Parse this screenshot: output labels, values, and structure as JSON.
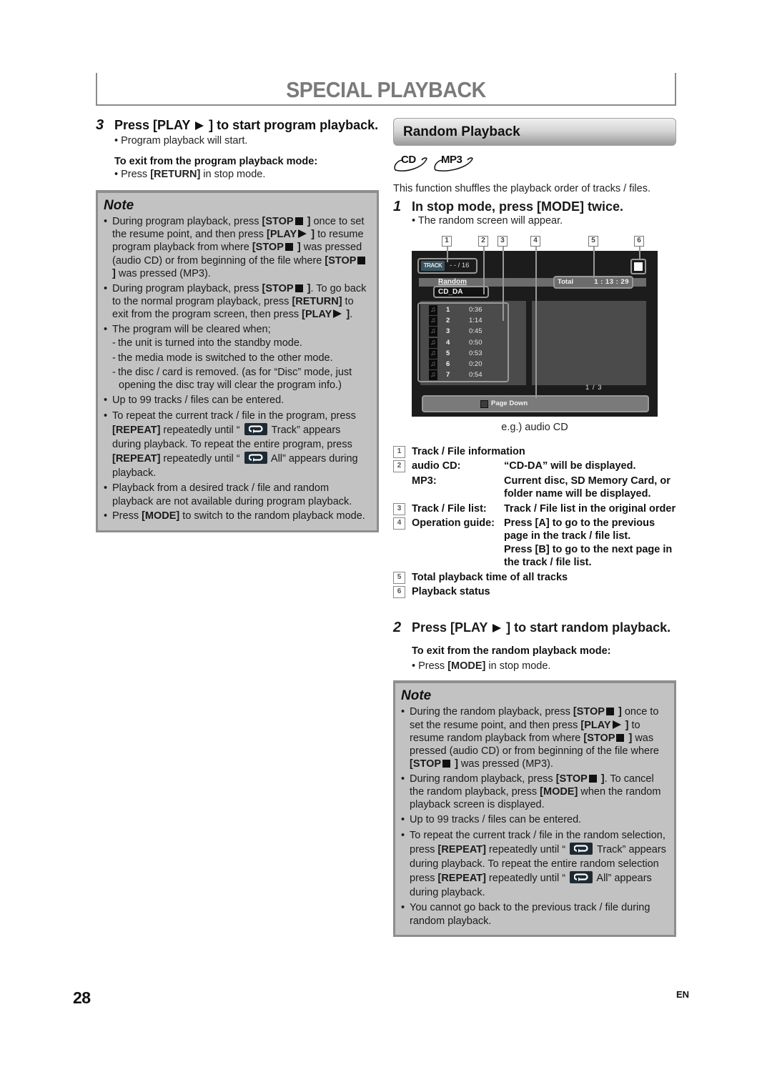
{
  "header": {
    "title": "SPECIAL PLAYBACK"
  },
  "left": {
    "step3": {
      "number": "3",
      "heading": "Press [PLAY ► ] to start program playback.",
      "heading_pre": "Press [PLAY",
      "heading_post": "] to start program playback.",
      "bullet": "• Program playback will start.",
      "exit_label": "To exit from the program playback mode:",
      "exit_bullet_pre": "• Press ",
      "exit_bullet_key": "[RETURN]",
      "exit_bullet_post": " in stop mode."
    },
    "note": {
      "title": "Note",
      "items": [
        "During program playback, press [STOP ■ ] once to set the resume point, and then press [PLAY ► ] to resume program playback from where [STOP ■ ] was pressed (audio CD) or from beginning of the file where [STOP ■ ] was pressed (MP3).",
        "During program playback, press [STOP ■ ]. To go back to the normal program playback, press [RETURN] to exit from the program screen, then press [PLAY ► ].",
        "The program will be cleared when;",
        "Up to 99 tracks / files can be entered.",
        "To repeat the current track / file in the program, press [REPEAT] repeatedly until “ [repeat] Track” appears during playback. To repeat the entire program, press [REPEAT] repeatedly until “ [repeat] All” appears during playback.",
        "Playback from a desired track / file and random playback are not available during program playback.",
        "Press [MODE] to switch to the random playback mode."
      ],
      "sub_items": [
        "- the unit is turned into the standby mode.",
        "- the media mode is switched to the other mode.",
        "- the disc / card is removed. (as for “Disc” mode, just opening the disc tray will clear the program info.)"
      ],
      "frag": {
        "i1a": "During program playback, press ",
        "stop": "[STOP",
        "close": " ]",
        "i1b": " once to set the resume point, and then press ",
        "play": "[PLAY",
        "i1c": " to resume program playback from where ",
        "i1d": " was pressed (audio CD) or from beginning of the file where ",
        "i1e": " was pressed (MP3).",
        "i2a": "During program playback, press ",
        "i2b": ". To go back to the normal program playback, press ",
        "return": "[RETURN]",
        "i2c": " to exit from the program screen, then press ",
        "i2d": ".",
        "i3": "The program will be cleared when;",
        "s1": "the unit is turned into the standby mode.",
        "s2": "the media mode is switched to the other mode.",
        "s3a": "the disc / card is removed. (as for “Disc” mode, just",
        "s3b": "opening the disc tray will clear the program info.)",
        "i4": "Up to 99 tracks / files can be entered.",
        "i5a": "To repeat the current track / file in the program, press ",
        "repeat": "[REPEAT]",
        "i5b": " repeatedly until “ ",
        "i5c": " Track” appears during playback. To repeat the entire program, press ",
        "i5d": " repeatedly until “ ",
        "i5e": " All” appears during playback.",
        "i6": "Playback from a desired track / file and random playback are not available during program playback.",
        "i7a": "Press ",
        "mode": "[MODE]",
        "i7b": " to switch to the random playback mode."
      }
    }
  },
  "right": {
    "section_title": "Random Playback",
    "media": [
      "CD",
      "MP3"
    ],
    "intro": "This function shuffles the playback order of tracks / files.",
    "step1": {
      "number": "1",
      "heading": "In stop mode, press [MODE] twice.",
      "bullet": "• The random screen will appear."
    },
    "screen": {
      "callouts": [
        "1",
        "2",
        "3",
        "4",
        "5",
        "6"
      ],
      "track_label": "TRACK",
      "track_count": "- - / 16",
      "mode_label": "Random",
      "media_name": "CD_DA",
      "total_label": "Total",
      "total_time": "1 : 13 : 29",
      "tracks": [
        {
          "num": "1",
          "time": "0:36"
        },
        {
          "num": "2",
          "time": "1:14"
        },
        {
          "num": "3",
          "time": "0:45"
        },
        {
          "num": "4",
          "time": "0:50"
        },
        {
          "num": "5",
          "time": "0:53"
        },
        {
          "num": "6",
          "time": "0:20"
        },
        {
          "num": "7",
          "time": "0:54"
        }
      ],
      "page_indicator": "1  /  3",
      "page_down_label": "Page Down",
      "caption": "e.g.) audio CD"
    },
    "legend": [
      {
        "num": "1",
        "key": "Track / File information",
        "value": ""
      },
      {
        "num": "2",
        "key": "audio CD:",
        "value": "“CD-DA” will be displayed."
      },
      {
        "num": "",
        "key": "MP3:",
        "value": "Current disc, SD Memory Card, or folder name will be displayed."
      },
      {
        "num": "3",
        "key": "Track / File list:",
        "value": "Track / File list in the original order"
      },
      {
        "num": "4",
        "key": "Operation guide:",
        "value": "Press [A] to go to the previous page in the track / file list.",
        "value2": "Press [B] to go to the next page in the track / file list."
      },
      {
        "num": "5",
        "key": "Total playback time of all tracks",
        "value": ""
      },
      {
        "num": "6",
        "key": "Playback status",
        "value": ""
      }
    ],
    "step2": {
      "number": "2",
      "heading_pre": "Press [PLAY",
      "heading_post": "] to start random playback.",
      "exit_label": "To exit from the random playback mode:",
      "exit_bullet_pre": "• Press ",
      "exit_bullet_key": "[MODE]",
      "exit_bullet_post": " in stop mode."
    },
    "note": {
      "title": "Note",
      "frag": {
        "i1a": "During the random playback, press ",
        "stop": "[STOP",
        "close": " ]",
        "i1b": " once to set the resume point, and then press ",
        "play": "[PLAY",
        "i1c": " to resume random playback from where ",
        "i1d": " was pressed (audio CD) or from beginning of the file where ",
        "i1e": " was pressed (MP3).",
        "i2a": "During random playback, press ",
        "i2b": ". To cancel the random playback, press ",
        "mode": "[MODE]",
        "i2c": " when the random playback screen is displayed.",
        "i3": "Up to 99 tracks / files can be entered.",
        "i4a": "To repeat the current track / file in the random selection, press ",
        "repeat": "[REPEAT]",
        "i4b": " repeatedly until “ ",
        "i4c": " Track” appears during playback. To repeat the entire random selection press ",
        "i4d": " repeatedly until “ ",
        "i4e": " All” appears during playback.",
        "i5": "You cannot go back to the previous track / file during random playback."
      }
    }
  },
  "footer": {
    "page_number": "28",
    "language": "EN"
  }
}
